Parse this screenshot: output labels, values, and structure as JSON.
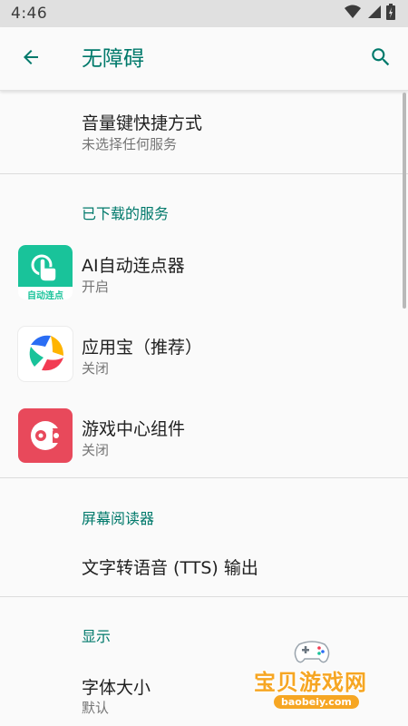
{
  "status_bar": {
    "time": "4:46",
    "icons": [
      "wifi-icon",
      "signal-icon",
      "battery-icon"
    ]
  },
  "app_bar": {
    "title": "无障碍",
    "back_icon": "arrow-back-icon",
    "search_icon": "search-icon"
  },
  "items": {
    "volume_shortcut": {
      "title": "音量键快捷方式",
      "subtitle": "未选择任何服务"
    },
    "downloaded_header": "已下载的服务",
    "services": [
      {
        "title": "AI自动连点器",
        "subtitle": "开启",
        "icon": "auto-clicker-app-icon",
        "icon_label": "自动连点"
      },
      {
        "title": "应用宝（推荐）",
        "subtitle": "关闭",
        "icon": "yingyongbao-app-icon"
      },
      {
        "title": "游戏中心组件",
        "subtitle": "关闭",
        "icon": "game-center-app-icon"
      }
    ],
    "screen_reader_header": "屏幕阅读器",
    "tts": {
      "title": "文字转语音 (TTS) 输出"
    },
    "display_header": "显示",
    "font_size": {
      "title": "字体大小",
      "subtitle": "默认"
    }
  },
  "watermark": {
    "text": "宝贝游戏网",
    "url": "baobeiy.com"
  },
  "colors": {
    "accent": "#00796b",
    "status_bar_bg": "#e0e0e0",
    "page_bg": "#fafafa",
    "watermark": "#f6a623"
  }
}
